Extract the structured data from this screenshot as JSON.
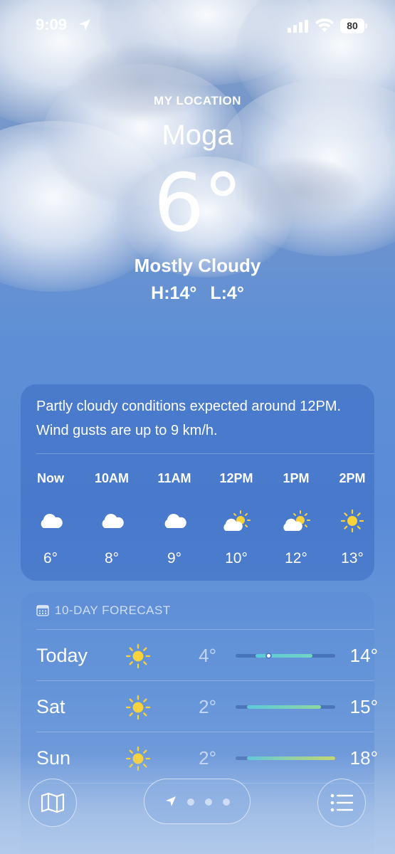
{
  "status_bar": {
    "time": "9:09",
    "battery": "80"
  },
  "location": {
    "label": "MY LOCATION",
    "city": "Moga",
    "temperature": "6°",
    "condition": "Mostly Cloudy",
    "high": "H:14°",
    "low": "L:4°"
  },
  "hourly": {
    "summary": "Partly cloudy conditions expected around 12PM. Wind gusts are up to 9 km/h.",
    "items": [
      {
        "label": "Now",
        "icon": "cloud-icon",
        "temp": "6°"
      },
      {
        "label": "10AM",
        "icon": "cloud-icon",
        "temp": "8°"
      },
      {
        "label": "11AM",
        "icon": "cloud-icon",
        "temp": "9°"
      },
      {
        "label": "12PM",
        "icon": "partly-sunny-icon",
        "temp": "10°"
      },
      {
        "label": "1PM",
        "icon": "partly-sunny-icon",
        "temp": "12°"
      },
      {
        "label": "2PM",
        "icon": "sun-icon",
        "temp": "13°"
      }
    ]
  },
  "forecast": {
    "title": "10-DAY FORECAST",
    "days": [
      {
        "day": "Today",
        "icon": "sun-icon",
        "low": "4°",
        "high": "14°"
      },
      {
        "day": "Sat",
        "icon": "sun-icon",
        "low": "2°",
        "high": "15°"
      },
      {
        "day": "Sun",
        "icon": "sun-icon",
        "low": "2°",
        "high": "18°"
      }
    ]
  },
  "colors": {
    "sun": "#f7d23a",
    "bar_cool": "#62d0d8",
    "bar_warm": "#b9d76a"
  }
}
